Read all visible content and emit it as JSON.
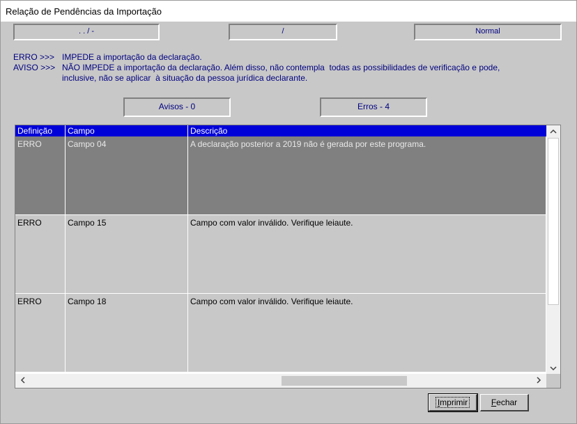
{
  "window": {
    "title": "Relação de Pendências da Importação"
  },
  "status_panels": {
    "date": ". . / -",
    "slash": "/",
    "mode": "Normal"
  },
  "legend": {
    "erro_code": "ERRO >>>",
    "erro_text": "IMPEDE a importação da declaração.",
    "aviso_code": "AVISO >>>",
    "aviso_text": "NÃO IMPEDE a importação da declaração. Além disso, não contempla  todas as possibilidades de verificação e pode,",
    "aviso_text2": "inclusive, não se aplicar  à situação da pessoa jurídica declarante."
  },
  "counters": {
    "avisos": "Avisos - 0",
    "erros": "Erros - 4"
  },
  "table": {
    "columns": [
      "Definição",
      "Campo",
      "Descrição"
    ],
    "rows": [
      {
        "definicao": "ERRO",
        "campo": "Campo 04",
        "descricao": "A declaração posterior a 2019 não é gerada por este programa.",
        "selected": true
      },
      {
        "definicao": "ERRO",
        "campo": "Campo 15",
        "descricao": "Campo com valor inválido. Verifique leiaute.",
        "selected": false
      },
      {
        "definicao": "ERRO",
        "campo": "Campo 18",
        "descricao": "Campo com valor inválido. Verifique leiaute.",
        "selected": false
      }
    ]
  },
  "buttons": {
    "print_first": "I",
    "print_rest": "mprimir",
    "close_first": "F",
    "close_rest": "echar"
  },
  "icons": {
    "scroll_up": "chevron-up-icon",
    "scroll_down": "chevron-down-icon",
    "scroll_left": "chevron-left-icon",
    "scroll_right": "chevron-right-icon"
  }
}
